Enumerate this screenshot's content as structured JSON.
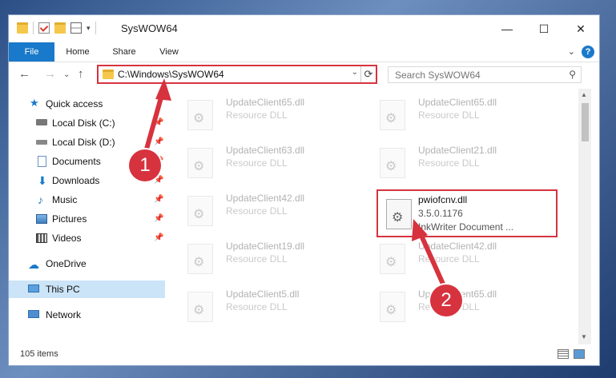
{
  "window": {
    "title": "SysWOW64",
    "controls": {
      "minimize": "—",
      "maximize": "☐",
      "close": "✕"
    }
  },
  "ribbon": {
    "tabs": [
      "File",
      "Home",
      "Share",
      "View"
    ],
    "help": "?"
  },
  "address": {
    "path": "C:\\Windows\\SysWOW64",
    "refresh": "⟳"
  },
  "search": {
    "placeholder": "Search SysWOW64"
  },
  "nav": {
    "quick_access": "Quick access",
    "items": [
      "Local Disk (C:)",
      "Local Disk (D:)",
      "Documents",
      "Downloads",
      "Music",
      "Pictures",
      "Videos"
    ],
    "onedrive": "OneDrive",
    "thispc": "This PC",
    "network": "Network"
  },
  "files": [
    {
      "name": "UpdateClient65.dll",
      "desc": "Resource DLL"
    },
    {
      "name": "UpdateClient65.dll",
      "desc": "Resource DLL"
    },
    {
      "name": "UpdateClient63.dll",
      "desc": "Resource DLL"
    },
    {
      "name": "UpdateClient21.dll",
      "desc": "Resource DLL"
    },
    {
      "name": "UpdateClient42.dll",
      "desc": "Resource DLL"
    },
    {
      "name": "UpdateClient19.dll",
      "desc": "Resource DLL"
    },
    {
      "name": "UpdateClient42.dll",
      "desc": "Resource DLL"
    },
    {
      "name": "UpdateClient5.dll",
      "desc": "Resource DLL"
    },
    {
      "name": "UpdateClient65.dll",
      "desc": "Resource DLL"
    }
  ],
  "highlighted_file": {
    "name": "pwiofcnv.dll",
    "version": "3.5.0.1176",
    "desc": "InkWriter Document ..."
  },
  "status": {
    "count": "105 items"
  },
  "callouts": {
    "one": "1",
    "two": "2"
  },
  "colors": {
    "accent": "#1979ca",
    "callout": "#d6333f"
  }
}
